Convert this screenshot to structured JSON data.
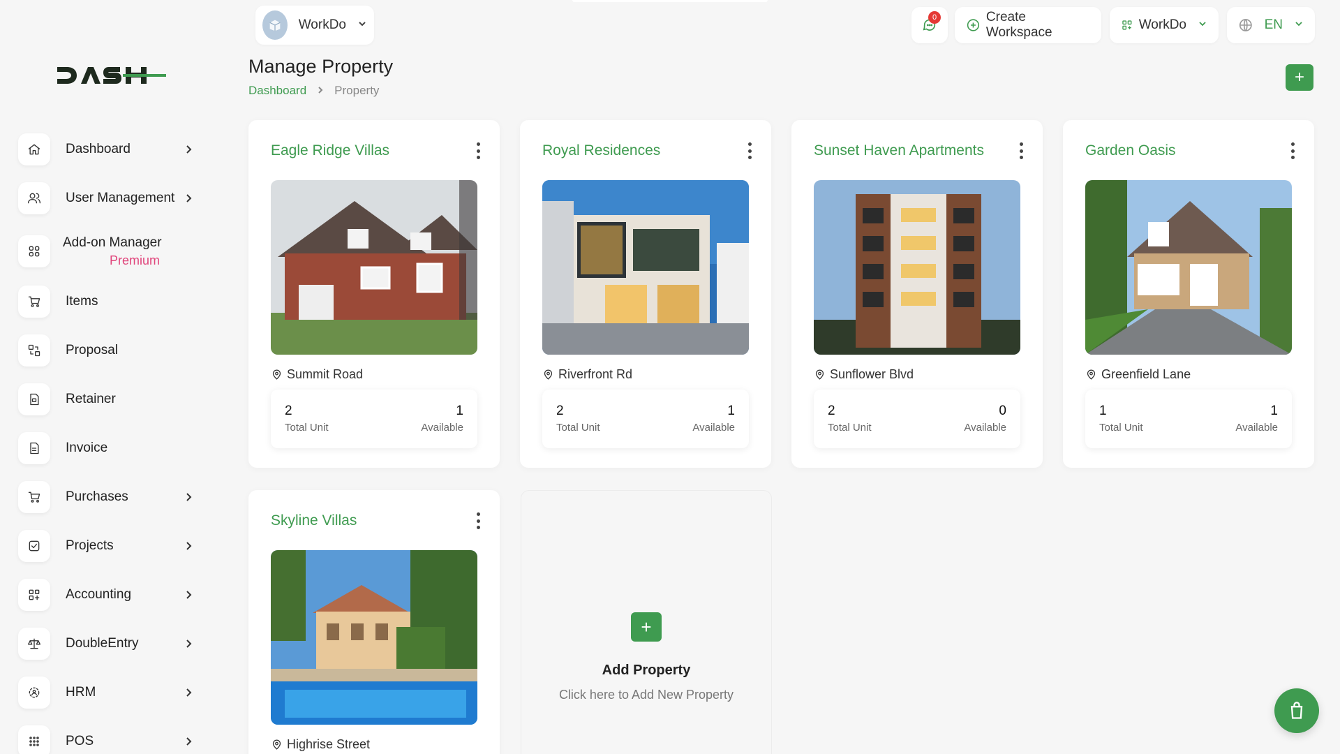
{
  "brand": {
    "logo_text": "DASH",
    "accent": "#3f9b50"
  },
  "topbar": {
    "workspace": "WorkDo",
    "notifications_count": "0",
    "create_workspace": "Create Workspace",
    "workspace_menu": "WorkDo",
    "language": "EN"
  },
  "page": {
    "title": "Manage Property",
    "breadcrumb": [
      "Dashboard",
      "Property"
    ]
  },
  "sidebar": {
    "items": [
      {
        "label": "Dashboard",
        "icon": "home-icon",
        "chevron": true
      },
      {
        "label": "User Management",
        "icon": "users-icon",
        "chevron": true
      },
      {
        "label": "Add-on Manager",
        "sub": "Premium",
        "icon": "grid-icon",
        "chevron": false
      },
      {
        "label": "Items",
        "icon": "cart-icon",
        "chevron": false
      },
      {
        "label": "Proposal",
        "icon": "swap-icon",
        "chevron": false
      },
      {
        "label": "Retainer",
        "icon": "file-icon",
        "chevron": false
      },
      {
        "label": "Invoice",
        "icon": "document-icon",
        "chevron": false
      },
      {
        "label": "Purchases",
        "icon": "cart-icon",
        "chevron": true
      },
      {
        "label": "Projects",
        "icon": "checkbox-icon",
        "chevron": true
      },
      {
        "label": "Accounting",
        "icon": "grid-plus-icon",
        "chevron": true
      },
      {
        "label": "DoubleEntry",
        "icon": "scale-icon",
        "chevron": true
      },
      {
        "label": "HRM",
        "icon": "people-circle-icon",
        "chevron": true
      },
      {
        "label": "POS",
        "icon": "dots-grid-icon",
        "chevron": true
      }
    ]
  },
  "properties": [
    {
      "name": "Eagle Ridge Villas",
      "location": "Summit Road",
      "total_unit": "2",
      "available": "1",
      "total_label": "Total Unit",
      "available_label": "Available"
    },
    {
      "name": "Royal Residences",
      "location": "Riverfront Rd",
      "total_unit": "2",
      "available": "1",
      "total_label": "Total Unit",
      "available_label": "Available"
    },
    {
      "name": "Sunset Haven Apartments",
      "location": "Sunflower Blvd",
      "total_unit": "2",
      "available": "0",
      "total_label": "Total Unit",
      "available_label": "Available"
    },
    {
      "name": "Garden Oasis",
      "location": "Greenfield Lane",
      "total_unit": "1",
      "available": "1",
      "total_label": "Total Unit",
      "available_label": "Available"
    },
    {
      "name": "Skyline Villas",
      "location": "Highrise Street"
    }
  ],
  "add_property": {
    "title": "Add Property",
    "subtitle": "Click here to Add New Property"
  }
}
